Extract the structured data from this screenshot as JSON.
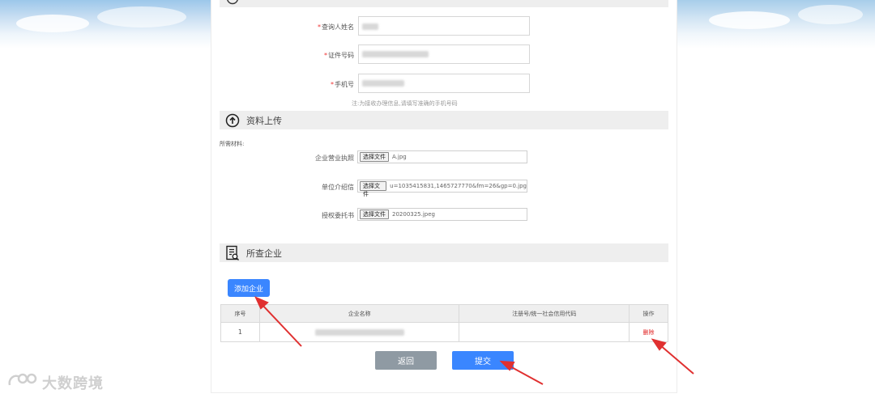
{
  "applicant": {
    "name_label": "查询人姓名",
    "id_label": "证件号码",
    "phone_label": "手机号",
    "phone_hint": "注:为接收办理信息,请填写准确的手机号码",
    "required_mark": "*"
  },
  "upload_section": {
    "title": "资料上传",
    "required_materials_label": "所需材料:",
    "files": [
      {
        "label": "企业营业执照",
        "button": "选择文件",
        "filename": "A.jpg"
      },
      {
        "label": "单位介绍信",
        "button": "选择文件",
        "filename": "u=1035415831,1465727770&fm=26&gp=0.jpg"
      },
      {
        "label": "授权委托书",
        "button": "选择文件",
        "filename": "20200325.jpeg"
      }
    ]
  },
  "company_section": {
    "title": "所查企业",
    "add_button": "添加企业",
    "table": {
      "headers": [
        "序号",
        "企业名称",
        "注册号/统一社会信用代码",
        "操作"
      ],
      "rows": [
        {
          "index": "1",
          "name": "",
          "code": "",
          "action": "删除"
        }
      ]
    }
  },
  "actions": {
    "back": "返回",
    "submit": "提交"
  },
  "watermark": {
    "text": "大数跨境"
  },
  "colors": {
    "primary": "#3a86ff",
    "back_button": "#8f9aa3",
    "delete": "#e02020",
    "required": "#e33333",
    "arrow": "#e03030"
  }
}
